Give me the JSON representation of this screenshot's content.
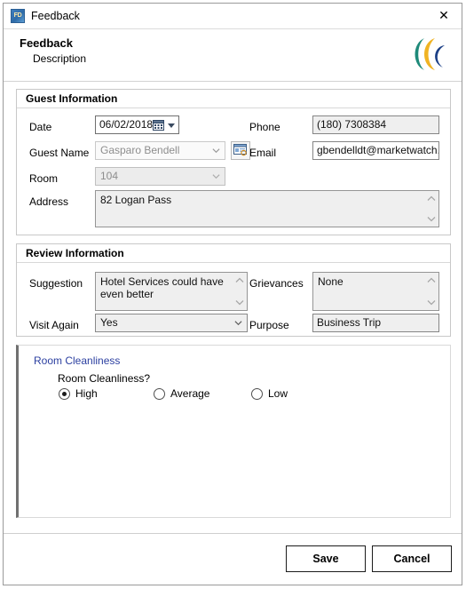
{
  "window": {
    "title": "Feedback",
    "app_icon": "FD",
    "close_label": "✕"
  },
  "header": {
    "title": "Feedback",
    "subtitle": "Description",
    "logo_icon": "crescent-logo"
  },
  "guest_information": {
    "legend": "Guest Information",
    "date": {
      "label": "Date",
      "value": "06/02/2018",
      "calendar_icon": "calendar-icon",
      "dropdown_icon": "chevron-down-icon"
    },
    "guest_name": {
      "label": "Guest Name",
      "value": "Gasparo Bendell"
    },
    "browse_button": {
      "icon": "window-browse-icon"
    },
    "room": {
      "label": "Room",
      "value": "104"
    },
    "address": {
      "label": "Address",
      "value": "82 Logan Pass"
    },
    "phone": {
      "label": "Phone",
      "value": "(180) 7308384"
    },
    "email": {
      "label": "Email",
      "value": "gbendelldt@marketwatch.com"
    }
  },
  "review_information": {
    "legend": "Review Information",
    "suggestion": {
      "label": "Suggestion",
      "value": "Hotel Services could have even better"
    },
    "grievances": {
      "label": "Grievances",
      "value": "None"
    },
    "visit_again": {
      "label": "Visit Again",
      "value": "Yes"
    },
    "purpose": {
      "label": "Purpose",
      "value": "Business Trip"
    }
  },
  "room_cleanliness": {
    "tab_label": "Room Cleanliness",
    "question": "Room Cleanliness?",
    "options": [
      {
        "label": "High",
        "selected": true
      },
      {
        "label": "Average",
        "selected": false
      },
      {
        "label": "Low",
        "selected": false
      }
    ]
  },
  "footer": {
    "save_label": "Save",
    "cancel_label": "Cancel"
  },
  "colors": {
    "tab_label": "#2b3fa0",
    "logo_teal": "#1f8a7a",
    "logo_gold": "#f0b323",
    "logo_navy": "#1b3f86"
  }
}
